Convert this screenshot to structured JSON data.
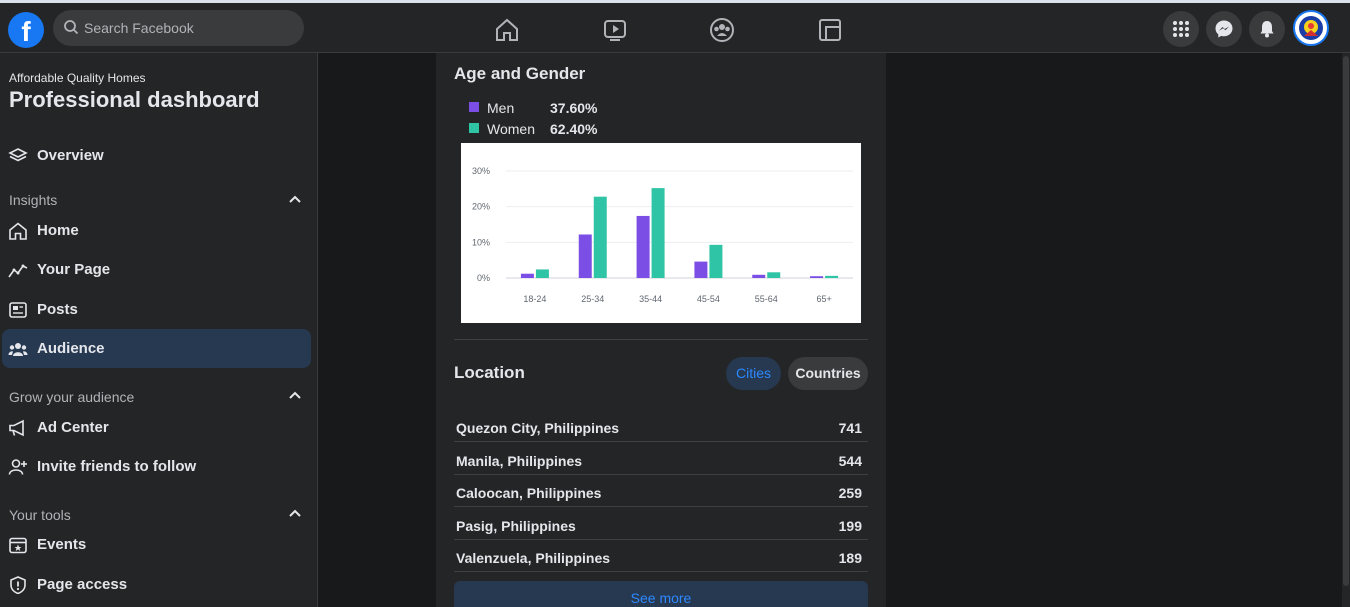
{
  "topbar": {
    "logo_letter": "f",
    "search_placeholder": "Search Facebook"
  },
  "sidebar": {
    "page_name": "Affordable Quality Homes",
    "title": "Professional dashboard",
    "overview": "Overview",
    "insights_header": "Insights",
    "insights_items": [
      {
        "label": "Home",
        "icon": "home-icon"
      },
      {
        "label": "Your Page",
        "icon": "trend-icon"
      },
      {
        "label": "Posts",
        "icon": "posts-icon"
      },
      {
        "label": "Audience",
        "icon": "audience-icon",
        "active": true
      }
    ],
    "grow_header": "Grow your audience",
    "grow_items": [
      {
        "label": "Ad Center",
        "icon": "megaphone-icon"
      },
      {
        "label": "Invite friends to follow",
        "icon": "invite-icon"
      }
    ],
    "tools_header": "Your tools",
    "tools_items": [
      {
        "label": "Events",
        "icon": "calendar-icon"
      },
      {
        "label": "Page access",
        "icon": "shield-icon"
      }
    ]
  },
  "age_gender": {
    "title": "Age and Gender",
    "legend": [
      {
        "label": "Men",
        "value": "37.60%",
        "color": "#7b4ee6"
      },
      {
        "label": "Women",
        "value": "62.40%",
        "color": "#2ec4a5"
      }
    ]
  },
  "chart_data": {
    "type": "bar",
    "categories": [
      "18-24",
      "25-34",
      "35-44",
      "45-54",
      "55-64",
      "65+"
    ],
    "series": [
      {
        "name": "Men",
        "values": [
          1.2,
          12.2,
          17.4,
          4.6,
          0.9,
          0.5
        ]
      },
      {
        "name": "Women",
        "values": [
          2.4,
          22.8,
          25.2,
          9.3,
          1.6,
          0.6
        ]
      }
    ],
    "yticks": [
      "0%",
      "10%",
      "20%",
      "30%"
    ],
    "ylim": [
      0,
      30
    ],
    "grid": true
  },
  "location": {
    "title": "Location",
    "tabs": [
      "Cities",
      "Countries"
    ],
    "rows": [
      {
        "name": "Quezon City, Philippines",
        "count": "741"
      },
      {
        "name": "Manila, Philippines",
        "count": "544"
      },
      {
        "name": "Caloocan, Philippines",
        "count": "259"
      },
      {
        "name": "Pasig, Philippines",
        "count": "199"
      },
      {
        "name": "Valenzuela, Philippines",
        "count": "189"
      }
    ],
    "see_more": "See more"
  }
}
